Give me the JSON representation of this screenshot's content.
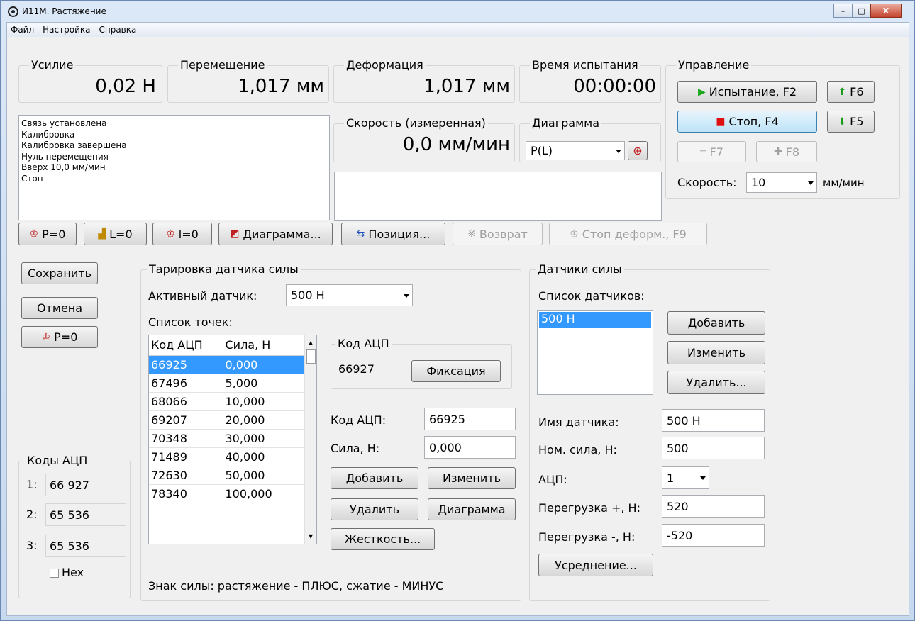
{
  "window": {
    "title": "И11М. Растяжение",
    "min": "–",
    "max": "□",
    "close": "X"
  },
  "menu": [
    "Файл",
    "Настройка",
    "Справка"
  ],
  "readings": {
    "force": {
      "caption": "Усилие",
      "value": "0,02 Н"
    },
    "displacement": {
      "caption": "Перемещение",
      "value": "1,017 мм"
    },
    "deformation": {
      "caption": "Деформация",
      "value": "1,017 мм"
    },
    "test_time": {
      "caption": "Время испытания",
      "value": "00:00:00"
    },
    "speed_measured": {
      "caption": "Скорость (измеренная)",
      "value": "0,0 мм/мин"
    }
  },
  "log": [
    "Связь установлена",
    "Калибровка",
    "Калибровка завершена",
    "Нуль перемещения",
    "Вверх 10,0 мм/мин",
    "Стоп"
  ],
  "diagram": {
    "caption": "Диаграмма",
    "value": "P(L)"
  },
  "control": {
    "caption": "Управление",
    "test_button": "Испытание, F2",
    "stop_button": "Стоп, F4",
    "f6": "F6",
    "f5": "F5",
    "f7": "F7",
    "f8": "F8",
    "speed_label": "Скорость:",
    "speed_value": "10",
    "speed_unit": "мм/мин"
  },
  "toolbar": {
    "p0": "P=0",
    "l0": "L=0",
    "i0": "l=0",
    "diagram": "Диаграмма...",
    "position": "Позиция...",
    "return": "Возврат",
    "stop_deform": "Стоп деформ., F9"
  },
  "left": {
    "save": "Сохранить",
    "cancel": "Отмена",
    "p0": "P=0"
  },
  "adc_codes": {
    "caption": "Коды АЦП",
    "rows": [
      {
        "label": "1:",
        "value": "66 927"
      },
      {
        "label": "2:",
        "value": "65 536"
      },
      {
        "label": "3:",
        "value": "65 536"
      }
    ],
    "hex": "Hex"
  },
  "calib": {
    "caption": "Тарировка датчика силы",
    "active_label": "Активный датчик:",
    "active_value": "500 Н",
    "points_label": "Список точек:",
    "columns": [
      "Код АЦП",
      "Сила, Н"
    ],
    "rows": [
      [
        "66925",
        "0,000"
      ],
      [
        "67496",
        "5,000"
      ],
      [
        "68066",
        "10,000"
      ],
      [
        "69207",
        "20,000"
      ],
      [
        "70348",
        "30,000"
      ],
      [
        "71489",
        "40,000"
      ],
      [
        "72630",
        "50,000"
      ],
      [
        "78340",
        "100,000"
      ]
    ],
    "adc_group_caption": "Код АЦП",
    "adc_current": "66927",
    "fix_button": "Фиксация",
    "adc_label": "Код АЦП:",
    "adc_value": "66925",
    "force_label": "Сила, Н:",
    "force_value": "0,000",
    "add": "Добавить",
    "edit": "Изменить",
    "delete": "Удалить",
    "diagram": "Диаграмма",
    "stiffness": "Жесткость...",
    "sign_note": "Знак силы: растяжение - ПЛЮС, сжатие - МИНУС"
  },
  "sensors": {
    "caption": "Датчики силы",
    "list_label": "Список датчиков:",
    "items": [
      "500 Н"
    ],
    "add": "Добавить",
    "edit": "Изменить",
    "delete": "Удалить...",
    "name_label": "Имя датчика:",
    "name_value": "500 Н",
    "nom_label": "Ном. сила, Н:",
    "nom_value": "500",
    "adc_label": "АЦП:",
    "adc_value": "1",
    "over_plus_label": "Перегрузка +, Н:",
    "over_plus_value": "520",
    "over_minus_label": "Перегрузка -, Н:",
    "over_minus_value": "-520",
    "averaging": "Усреднение..."
  },
  "colors": {
    "play": "#1fa81f",
    "stop": "#e01010",
    "up": "#1a9b1a",
    "down": "#1a9b1a",
    "selection": "#3399ff"
  }
}
